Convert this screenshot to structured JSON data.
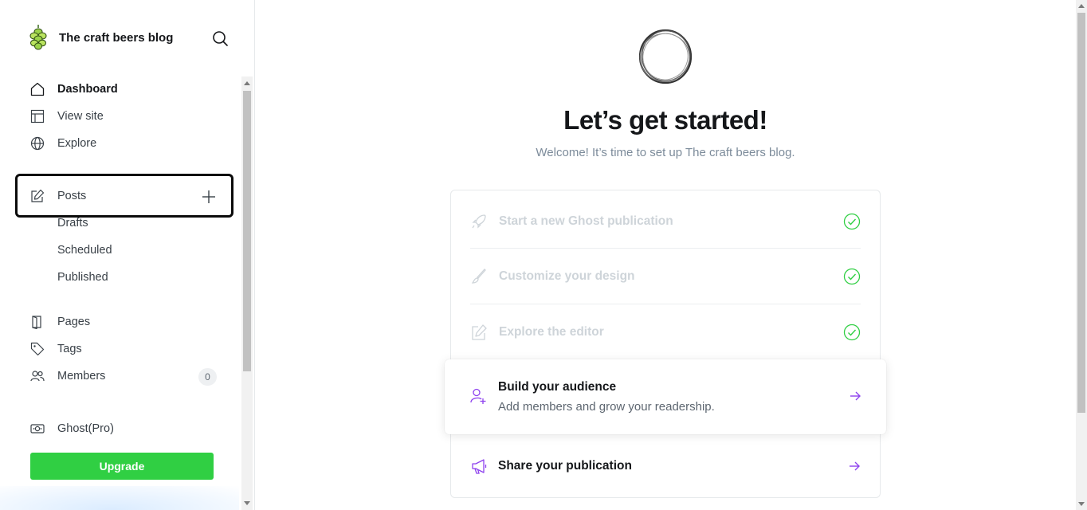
{
  "brand": {
    "title": "The craft beers blog",
    "logo_icon": "hop-icon"
  },
  "search": {
    "icon": "search-icon"
  },
  "nav": {
    "dashboard": "Dashboard",
    "view_site": "View site",
    "explore": "Explore",
    "posts": "Posts",
    "drafts": "Drafts",
    "scheduled": "Scheduled",
    "published": "Published",
    "pages": "Pages",
    "tags": "Tags",
    "members": "Members",
    "members_count": "0",
    "ghost_pro": "Ghost(Pro)"
  },
  "upgrade": {
    "label": "Upgrade",
    "color": "#30cf43"
  },
  "main": {
    "title": "Let’s get started!",
    "subtitle": "Welcome! It’s time to set up The craft beers blog.",
    "steps": [
      {
        "label": "Start a new Ghost publication",
        "icon": "rocket-icon",
        "done": true
      },
      {
        "label": "Customize your design",
        "icon": "brush-icon",
        "done": true
      },
      {
        "label": "Explore the editor",
        "icon": "edit-icon",
        "done": true
      }
    ],
    "active_step": {
      "title": "Build your audience",
      "description": "Add members and grow your readership.",
      "icon": "add-member-icon"
    },
    "share_step": {
      "title": "Share your publication",
      "icon": "megaphone-icon"
    }
  },
  "colors": {
    "accent_purple": "#8e42ee",
    "check_green": "#30cf43"
  }
}
